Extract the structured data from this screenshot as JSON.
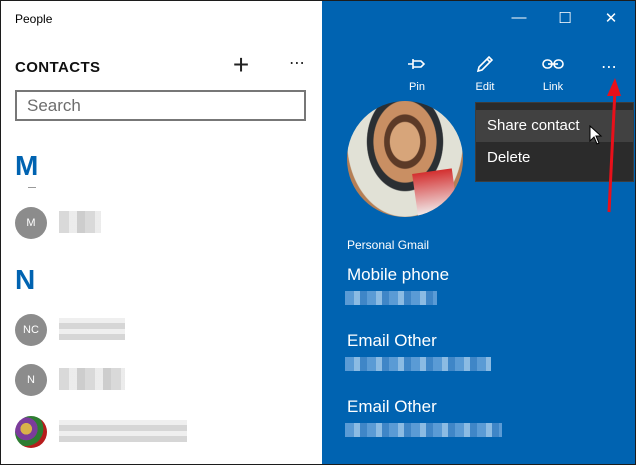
{
  "window": {
    "title": "People",
    "controls": {
      "minimize": "—",
      "maximize": "☐",
      "close": "✕"
    }
  },
  "left": {
    "heading": "CONTACTS",
    "add_glyph": "+",
    "more_glyph": "⋯",
    "search": {
      "placeholder": "Search",
      "value": ""
    },
    "groups": [
      {
        "letter": "M",
        "contacts": [
          {
            "initials": "M"
          }
        ]
      },
      {
        "letter": "N",
        "contacts": [
          {
            "initials": "NC"
          },
          {
            "initials": "N"
          },
          {
            "initials": ""
          }
        ]
      }
    ]
  },
  "toolbar": {
    "pin": {
      "label": "Pin",
      "icon": "pin-icon"
    },
    "edit": {
      "label": "Edit",
      "icon": "pencil-icon"
    },
    "link": {
      "label": "Link",
      "icon": "link-icon"
    },
    "more_glyph": "⋯"
  },
  "detail": {
    "account": "Personal Gmail",
    "fields": [
      {
        "label": "Mobile phone"
      },
      {
        "label": "Email Other"
      },
      {
        "label": "Email Other"
      }
    ]
  },
  "menu": {
    "items": [
      {
        "label": "Share contact",
        "highlighted": true
      },
      {
        "label": "Delete",
        "highlighted": false
      }
    ]
  },
  "colors": {
    "accent": "#0063b1",
    "menu_bg": "#2b2b2b",
    "annotation_arrow": "#e8101a"
  }
}
